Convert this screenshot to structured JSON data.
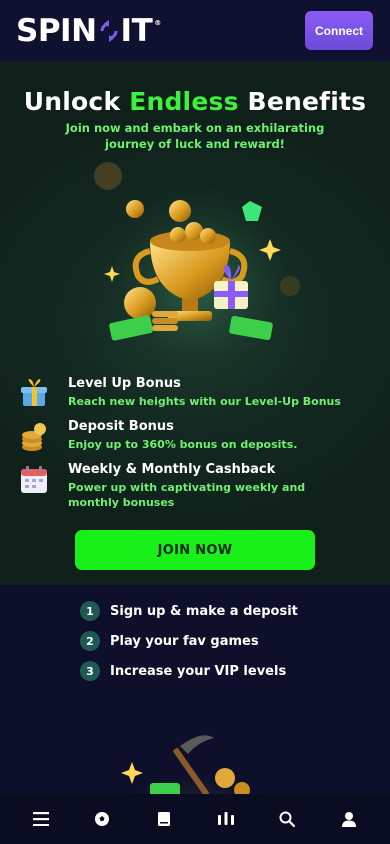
{
  "header": {
    "logo_left": "SPIN",
    "logo_right": "IT",
    "logo_mark": "®",
    "connect_label": "Connect"
  },
  "hero": {
    "title_start": "Unlock ",
    "title_highlight": "Endless",
    "title_end": " Benefits",
    "subtitle": "Join now and embark on an exhilarating journey of luck and reward!",
    "image_icon": "trophy-with-coins-icon"
  },
  "benefits": [
    {
      "icon": "gift-icon",
      "title": "Level Up Bonus",
      "desc": "Reach new heights with our Level-Up Bonus"
    },
    {
      "icon": "coin-stack-icon",
      "title": "Deposit Bonus",
      "desc": "Enjoy up to 360% bonus on deposits."
    },
    {
      "icon": "calendar-icon",
      "title": "Weekly & Monthly Cashback",
      "desc": "Power up with captivating weekly and monthly bonuses"
    }
  ],
  "join_label": "JOIN NOW",
  "steps": [
    {
      "num": "1",
      "text": "Sign up & make a deposit"
    },
    {
      "num": "2",
      "text": "Play your fav games"
    },
    {
      "num": "3",
      "text": "Increase your VIP levels"
    }
  ],
  "bottom_nav": [
    {
      "icon": "menu-icon"
    },
    {
      "icon": "soccer-ball-icon"
    },
    {
      "icon": "book-icon"
    },
    {
      "icon": "casino-icon"
    },
    {
      "icon": "search-icon"
    },
    {
      "icon": "user-icon"
    }
  ],
  "colors": {
    "accent_green": "#19f019",
    "highlight_green": "#3df23d",
    "connect_purple": "#8b5cf6",
    "background": "#0d0f2b"
  }
}
